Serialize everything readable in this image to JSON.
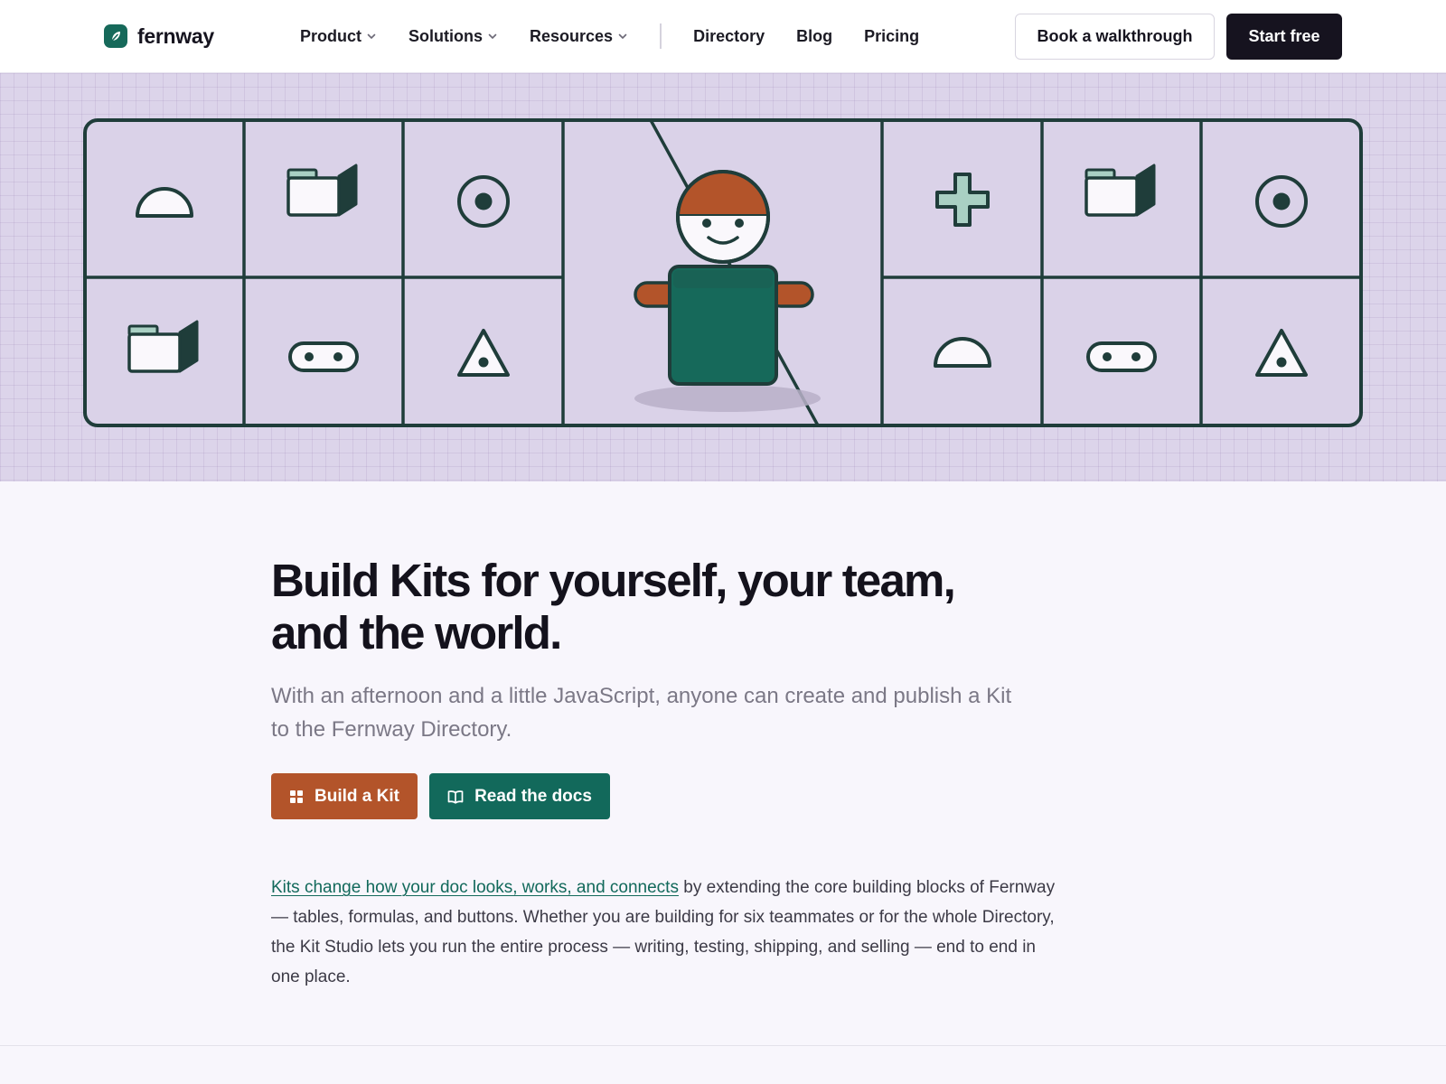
{
  "brand": {
    "name": "fernway",
    "accent": "#16695a"
  },
  "nav": {
    "items": [
      {
        "label": "Product",
        "dropdown": true
      },
      {
        "label": "Solutions",
        "dropdown": true
      },
      {
        "label": "Resources",
        "dropdown": true
      },
      {
        "label": "Directory",
        "dropdown": false
      },
      {
        "label": "Blog",
        "dropdown": false
      },
      {
        "label": "Pricing",
        "dropdown": false
      }
    ],
    "walkthrough_label": "Book a walkthrough",
    "start_label": "Start free"
  },
  "hero": {
    "illustration": "kit-grid-with-character",
    "background_color": "#dcd4ea",
    "tiles_left": [
      "half-circle-icon",
      "box-icon",
      "target-icon",
      "box-icon",
      "pill-icon",
      "triangle-icon"
    ],
    "tiles_right": [
      "plus-icon",
      "box-icon",
      "target-icon",
      "half-circle-icon",
      "pill-icon",
      "triangle-icon"
    ]
  },
  "main": {
    "headline_line1": "Build Kits for yourself, your team,",
    "headline_line2": "and the world.",
    "subtitle": "With an afternoon and a little JavaScript, anyone can create and publish a Kit to the Fernway Directory.",
    "build_button": {
      "label": "Build a Kit",
      "icon": "grid-icon",
      "color": "#b3542a"
    },
    "docs_button": {
      "label": "Read the docs",
      "icon": "book-icon",
      "color": "#12695b"
    },
    "body_link": "Kits change how your doc looks, works, and connects",
    "body_rest": " by extending the core building blocks of Fernway — tables, formulas, and buttons. Whether you are building for six teammates or for the whole Directory, the Kit Studio lets you run the entire process — writing, testing, shipping, and selling — end to end in one place."
  }
}
